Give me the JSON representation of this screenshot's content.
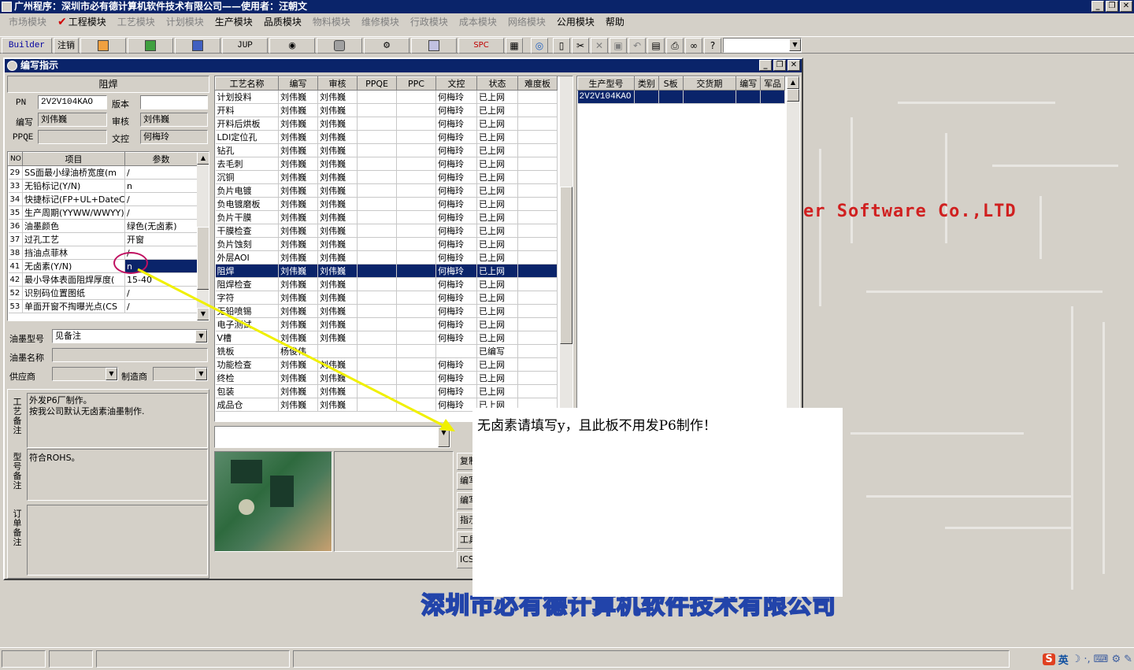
{
  "app": {
    "title": "广州程序：深圳市必有德计算机软件技术有限公司——使用者：汪朝文",
    "window_buttons": [
      "_",
      "❐",
      "✕"
    ]
  },
  "menu": [
    {
      "label": "市场模块",
      "dim": true
    },
    {
      "label": "工程模块",
      "dim": false,
      "checked": true
    },
    {
      "label": "工艺模块",
      "dim": true
    },
    {
      "label": "计划模块",
      "dim": true
    },
    {
      "label": "生产模块",
      "dim": false
    },
    {
      "label": "品质模块",
      "dim": false
    },
    {
      "label": "物料模块",
      "dim": true
    },
    {
      "label": "维修模块",
      "dim": true
    },
    {
      "label": "行政模块",
      "dim": true
    },
    {
      "label": "成本模块",
      "dim": true
    },
    {
      "label": "网络模块",
      "dim": true
    },
    {
      "label": "公用模块",
      "dim": false
    },
    {
      "label": "帮助",
      "dim": false
    }
  ],
  "toolbar": {
    "builder_label": "Builder",
    "logout_label": "注销",
    "jup_label": "JUP",
    "spc_label": "SPC"
  },
  "child_window": {
    "title": "编写指示",
    "header_title": "阻焊",
    "pn_label": "PN",
    "pn_value": "2V2V104KAO",
    "version_label": "版本",
    "version_value": "",
    "writer_label": "编写",
    "writer_value": "刘伟巍",
    "reviewer_label": "审核",
    "reviewer_value": "刘伟巍",
    "ppqe_label": "PPQE",
    "ppqe_value": "",
    "doc_control_label": "文控",
    "doc_control_value": "何梅玲"
  },
  "params_table": {
    "columns": [
      "NO",
      "项目",
      "参数"
    ],
    "rows": [
      {
        "no": "29",
        "item": "SS面最小绿油桥宽度(m",
        "value": "/"
      },
      {
        "no": "33",
        "item": "无铅标记(Y/N)",
        "value": "n"
      },
      {
        "no": "34",
        "item": "快捷标记(FP+UL+DateCo",
        "value": "/"
      },
      {
        "no": "35",
        "item": "生产周期(YYWW/WWYY)",
        "value": "/"
      },
      {
        "no": "36",
        "item": "油墨颜色",
        "value": "绿色(无卤素)"
      },
      {
        "no": "37",
        "item": "过孔工艺",
        "value": "开窗"
      },
      {
        "no": "38",
        "item": "挡油点菲林",
        "value": "/"
      },
      {
        "no": "41",
        "item": "无卤素(Y/N)",
        "value": "n",
        "selected": true
      },
      {
        "no": "42",
        "item": "最小导体表面阻焊厚度(",
        "value": "15-40"
      },
      {
        "no": "52",
        "item": "识别码位置图纸",
        "value": "/"
      },
      {
        "no": "53",
        "item": "单面开窗不掏曝光点(CS",
        "value": "/"
      }
    ]
  },
  "ink": {
    "type_label": "油墨型号",
    "type_value": "见备注",
    "name_label": "油墨名称",
    "name_value": "",
    "supplier_label": "供应商",
    "supplier_value": "",
    "maker_label": "制造商",
    "maker_value": ""
  },
  "remarks": {
    "process_label": "工艺备注",
    "process_text": "外发P6厂制作。\n按我公司默认无卤素油墨制作.",
    "model_label": "型号备注",
    "model_text": "符合ROHS。",
    "order_label": "订单备注",
    "order_text": ""
  },
  "process_table": {
    "columns": [
      "工艺名称",
      "编写",
      "审核",
      "PPQE",
      "PPC",
      "文控",
      "状态",
      "难度板"
    ],
    "rows": [
      [
        "计划投料",
        "刘伟巍",
        "刘伟巍",
        "",
        "",
        "何梅玲",
        "已上网",
        ""
      ],
      [
        "开料",
        "刘伟巍",
        "刘伟巍",
        "",
        "",
        "何梅玲",
        "已上网",
        ""
      ],
      [
        "开料后烘板",
        "刘伟巍",
        "刘伟巍",
        "",
        "",
        "何梅玲",
        "已上网",
        ""
      ],
      [
        "LDI定位孔",
        "刘伟巍",
        "刘伟巍",
        "",
        "",
        "何梅玲",
        "已上网",
        ""
      ],
      [
        "钻孔",
        "刘伟巍",
        "刘伟巍",
        "",
        "",
        "何梅玲",
        "已上网",
        ""
      ],
      [
        "去毛刺",
        "刘伟巍",
        "刘伟巍",
        "",
        "",
        "何梅玲",
        "已上网",
        ""
      ],
      [
        "沉铜",
        "刘伟巍",
        "刘伟巍",
        "",
        "",
        "何梅玲",
        "已上网",
        ""
      ],
      [
        "负片电镀",
        "刘伟巍",
        "刘伟巍",
        "",
        "",
        "何梅玲",
        "已上网",
        ""
      ],
      [
        "负电镀磨板",
        "刘伟巍",
        "刘伟巍",
        "",
        "",
        "何梅玲",
        "已上网",
        ""
      ],
      [
        "负片干膜",
        "刘伟巍",
        "刘伟巍",
        "",
        "",
        "何梅玲",
        "已上网",
        ""
      ],
      [
        "干膜检查",
        "刘伟巍",
        "刘伟巍",
        "",
        "",
        "何梅玲",
        "已上网",
        ""
      ],
      [
        "负片蚀刻",
        "刘伟巍",
        "刘伟巍",
        "",
        "",
        "何梅玲",
        "已上网",
        ""
      ],
      [
        "外层AOI",
        "刘伟巍",
        "刘伟巍",
        "",
        "",
        "何梅玲",
        "已上网",
        ""
      ],
      [
        "阻焊",
        "刘伟巍",
        "刘伟巍",
        "",
        "",
        "何梅玲",
        "已上网",
        ""
      ],
      [
        "阻焊检查",
        "刘伟巍",
        "刘伟巍",
        "",
        "",
        "何梅玲",
        "已上网",
        ""
      ],
      [
        "字符",
        "刘伟巍",
        "刘伟巍",
        "",
        "",
        "何梅玲",
        "已上网",
        ""
      ],
      [
        "无铅喷锡",
        "刘伟巍",
        "刘伟巍",
        "",
        "",
        "何梅玲",
        "已上网",
        ""
      ],
      [
        "电子测试",
        "刘伟巍",
        "刘伟巍",
        "",
        "",
        "何梅玲",
        "已上网",
        ""
      ],
      [
        "V槽",
        "刘伟巍",
        "刘伟巍",
        "",
        "",
        "何梅玲",
        "已上网",
        ""
      ],
      [
        "铣板",
        "杨俊伟",
        "",
        "",
        "",
        "",
        "已编写",
        ""
      ],
      [
        "功能检查",
        "刘伟巍",
        "刘伟巍",
        "",
        "",
        "何梅玲",
        "已上网",
        ""
      ],
      [
        "终检",
        "刘伟巍",
        "刘伟巍",
        "",
        "",
        "何梅玲",
        "已上网",
        ""
      ],
      [
        "包装",
        "刘伟巍",
        "刘伟巍",
        "",
        "",
        "何梅玲",
        "已上网",
        ""
      ],
      [
        "成品仓",
        "刘伟巍",
        "刘伟巍",
        "",
        "",
        "何梅玲",
        "已上网",
        ""
      ]
    ],
    "selected_index": 13
  },
  "product_table": {
    "columns": [
      "生产型号",
      "类别",
      "S板",
      "交货期",
      "编写",
      "军品"
    ],
    "rows": [
      [
        "2V2V104KAO",
        "",
        "",
        "",
        "",
        ""
      ]
    ]
  },
  "side_buttons": [
    "复制",
    "编写",
    "编写",
    "指示",
    "工具",
    "ICS"
  ],
  "callout": {
    "text": "无卤素请填写y，且此板不用发P6制作！"
  },
  "branding": {
    "english": "er Software Co.,LTD",
    "chinese": "深圳市必有德计算机软件技术有限公司"
  },
  "ime": {
    "lang": "英"
  }
}
